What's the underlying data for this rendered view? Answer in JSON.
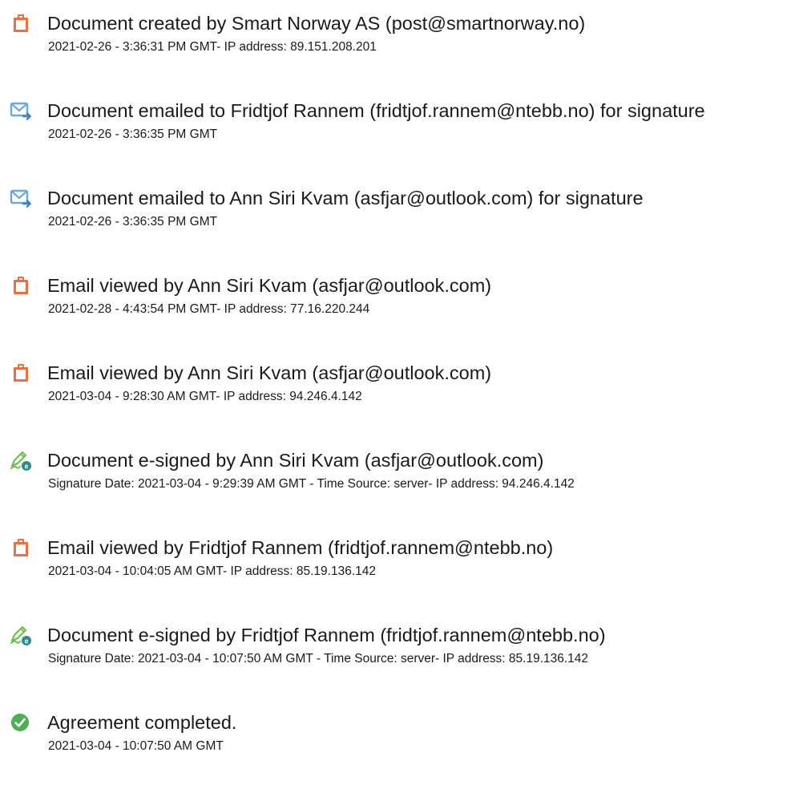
{
  "colors": {
    "document_icon": "#f26d3d",
    "email_icon": "#6aa8e0",
    "esign_icon": "#6cc04a",
    "check_icon": "#4caf50",
    "text": "#1a1a1a"
  },
  "events": [
    {
      "icon": "document-icon",
      "title": "Document created by Smart Norway AS (post@smartnorway.no)",
      "detail": "2021-02-26 - 3:36:31 PM GMT- IP address: 89.151.208.201"
    },
    {
      "icon": "email-icon",
      "title": "Document emailed to Fridtjof Rannem (fridtjof.rannem@ntebb.no) for signature",
      "detail": "2021-02-26 - 3:36:35 PM GMT"
    },
    {
      "icon": "email-icon",
      "title": "Document emailed to Ann Siri Kvam (asfjar@outlook.com) for signature",
      "detail": "2021-02-26 - 3:36:35 PM GMT"
    },
    {
      "icon": "document-icon",
      "title": "Email viewed by Ann Siri Kvam (asfjar@outlook.com)",
      "detail": "2021-02-28 - 4:43:54 PM GMT- IP address: 77.16.220.244"
    },
    {
      "icon": "document-icon",
      "title": "Email viewed by Ann Siri Kvam (asfjar@outlook.com)",
      "detail": "2021-03-04 - 9:28:30 AM GMT- IP address: 94.246.4.142"
    },
    {
      "icon": "esign-icon",
      "title": "Document e-signed by Ann Siri Kvam (asfjar@outlook.com)",
      "detail": "Signature Date: 2021-03-04 - 9:29:39 AM GMT - Time Source: server- IP address: 94.246.4.142"
    },
    {
      "icon": "document-icon",
      "title": "Email viewed by Fridtjof Rannem (fridtjof.rannem@ntebb.no)",
      "detail": "2021-03-04 - 10:04:05 AM GMT- IP address: 85.19.136.142"
    },
    {
      "icon": "esign-icon",
      "title": "Document e-signed by Fridtjof Rannem (fridtjof.rannem@ntebb.no)",
      "detail": "Signature Date: 2021-03-04 - 10:07:50 AM GMT - Time Source: server- IP address: 85.19.136.142"
    },
    {
      "icon": "check-icon",
      "title": "Agreement completed.",
      "detail": "2021-03-04 - 10:07:50 AM GMT"
    }
  ]
}
